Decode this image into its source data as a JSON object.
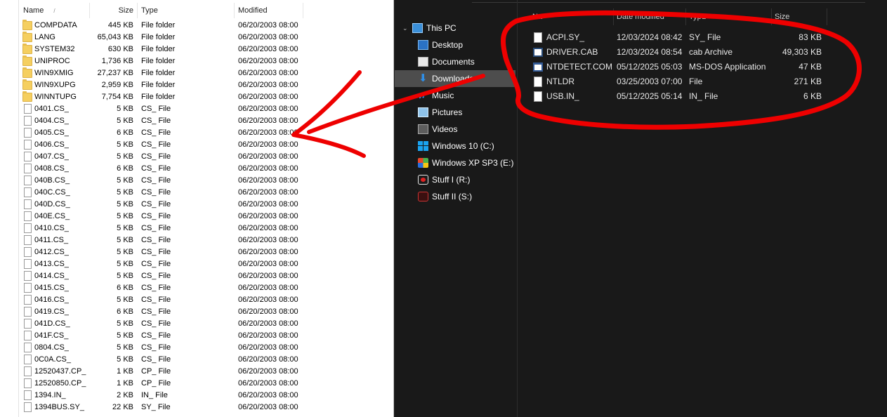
{
  "left_pane": {
    "columns": {
      "name": "Name",
      "size": "Size",
      "type": "Type",
      "modified": "Modified"
    },
    "rows": [
      {
        "name": "COMPDATA",
        "size": "445 KB",
        "type": "File folder",
        "modified": "06/20/2003 08:00",
        "icon": "folder-icon"
      },
      {
        "name": "LANG",
        "size": "65,043 KB",
        "type": "File folder",
        "modified": "06/20/2003 08:00",
        "icon": "folder-icon"
      },
      {
        "name": "SYSTEM32",
        "size": "630 KB",
        "type": "File folder",
        "modified": "06/20/2003 08:00",
        "icon": "folder-icon"
      },
      {
        "name": "UNIPROC",
        "size": "1,736 KB",
        "type": "File folder",
        "modified": "06/20/2003 08:00",
        "icon": "folder-icon"
      },
      {
        "name": "WIN9XMIG",
        "size": "27,237 KB",
        "type": "File folder",
        "modified": "06/20/2003 08:00",
        "icon": "folder-icon"
      },
      {
        "name": "WIN9XUPG",
        "size": "2,959 KB",
        "type": "File folder",
        "modified": "06/20/2003 08:00",
        "icon": "folder-icon"
      },
      {
        "name": "WINNTUPG",
        "size": "7,754 KB",
        "type": "File folder",
        "modified": "06/20/2003 08:00",
        "icon": "folder-icon"
      },
      {
        "name": "0401.CS_",
        "size": "5 KB",
        "type": "CS_ File",
        "modified": "06/20/2003 08:00",
        "icon": "file-icon"
      },
      {
        "name": "0404.CS_",
        "size": "5 KB",
        "type": "CS_ File",
        "modified": "06/20/2003 08:00",
        "icon": "file-icon"
      },
      {
        "name": "0405.CS_",
        "size": "6 KB",
        "type": "CS_ File",
        "modified": "06/20/2003 08:00",
        "icon": "file-icon"
      },
      {
        "name": "0406.CS_",
        "size": "5 KB",
        "type": "CS_ File",
        "modified": "06/20/2003 08:00",
        "icon": "file-icon"
      },
      {
        "name": "0407.CS_",
        "size": "5 KB",
        "type": "CS_ File",
        "modified": "06/20/2003 08:00",
        "icon": "file-icon"
      },
      {
        "name": "0408.CS_",
        "size": "6 KB",
        "type": "CS_ File",
        "modified": "06/20/2003 08:00",
        "icon": "file-icon"
      },
      {
        "name": "040B.CS_",
        "size": "5 KB",
        "type": "CS_ File",
        "modified": "06/20/2003 08:00",
        "icon": "file-icon"
      },
      {
        "name": "040C.CS_",
        "size": "5 KB",
        "type": "CS_ File",
        "modified": "06/20/2003 08:00",
        "icon": "file-icon"
      },
      {
        "name": "040D.CS_",
        "size": "5 KB",
        "type": "CS_ File",
        "modified": "06/20/2003 08:00",
        "icon": "file-icon"
      },
      {
        "name": "040E.CS_",
        "size": "5 KB",
        "type": "CS_ File",
        "modified": "06/20/2003 08:00",
        "icon": "file-icon"
      },
      {
        "name": "0410.CS_",
        "size": "5 KB",
        "type": "CS_ File",
        "modified": "06/20/2003 08:00",
        "icon": "file-icon"
      },
      {
        "name": "0411.CS_",
        "size": "5 KB",
        "type": "CS_ File",
        "modified": "06/20/2003 08:00",
        "icon": "file-icon"
      },
      {
        "name": "0412.CS_",
        "size": "5 KB",
        "type": "CS_ File",
        "modified": "06/20/2003 08:00",
        "icon": "file-icon"
      },
      {
        "name": "0413.CS_",
        "size": "5 KB",
        "type": "CS_ File",
        "modified": "06/20/2003 08:00",
        "icon": "file-icon"
      },
      {
        "name": "0414.CS_",
        "size": "5 KB",
        "type": "CS_ File",
        "modified": "06/20/2003 08:00",
        "icon": "file-icon"
      },
      {
        "name": "0415.CS_",
        "size": "6 KB",
        "type": "CS_ File",
        "modified": "06/20/2003 08:00",
        "icon": "file-icon"
      },
      {
        "name": "0416.CS_",
        "size": "5 KB",
        "type": "CS_ File",
        "modified": "06/20/2003 08:00",
        "icon": "file-icon"
      },
      {
        "name": "0419.CS_",
        "size": "6 KB",
        "type": "CS_ File",
        "modified": "06/20/2003 08:00",
        "icon": "file-icon"
      },
      {
        "name": "041D.CS_",
        "size": "5 KB",
        "type": "CS_ File",
        "modified": "06/20/2003 08:00",
        "icon": "file-icon"
      },
      {
        "name": "041F.CS_",
        "size": "5 KB",
        "type": "CS_ File",
        "modified": "06/20/2003 08:00",
        "icon": "file-icon"
      },
      {
        "name": "0804.CS_",
        "size": "5 KB",
        "type": "CS_ File",
        "modified": "06/20/2003 08:00",
        "icon": "file-icon"
      },
      {
        "name": "0C0A.CS_",
        "size": "5 KB",
        "type": "CS_ File",
        "modified": "06/20/2003 08:00",
        "icon": "file-icon"
      },
      {
        "name": "12520437.CP_",
        "size": "1 KB",
        "type": "CP_ File",
        "modified": "06/20/2003 08:00",
        "icon": "file-icon"
      },
      {
        "name": "12520850.CP_",
        "size": "1 KB",
        "type": "CP_ File",
        "modified": "06/20/2003 08:00",
        "icon": "file-icon"
      },
      {
        "name": "1394.IN_",
        "size": "2 KB",
        "type": "IN_ File",
        "modified": "06/20/2003 08:00",
        "icon": "file-icon"
      },
      {
        "name": "1394BUS.SY_",
        "size": "22 KB",
        "type": "SY_ File",
        "modified": "06/20/2003 08:00",
        "icon": "file-icon"
      }
    ]
  },
  "right_pane": {
    "columns": {
      "name": "Na",
      "date": "Date modified",
      "type": "Type",
      "size": "Size"
    },
    "nav": [
      {
        "label": "This PC",
        "icon": "computer-icon",
        "level": "root",
        "selected": false
      },
      {
        "label": "Desktop",
        "icon": "desktop-icon",
        "level": "child",
        "selected": false
      },
      {
        "label": "Documents",
        "icon": "documents-icon",
        "level": "child",
        "selected": false
      },
      {
        "label": "Downloads",
        "icon": "downloads-icon",
        "level": "child",
        "selected": true
      },
      {
        "label": "Music",
        "icon": "music-icon",
        "level": "child",
        "selected": false
      },
      {
        "label": "Pictures",
        "icon": "pictures-icon",
        "level": "child",
        "selected": false
      },
      {
        "label": "Videos",
        "icon": "videos-icon",
        "level": "child",
        "selected": false
      },
      {
        "label": "Windows 10 (C:)",
        "icon": "windows-drive-icon",
        "level": "child",
        "selected": false
      },
      {
        "label": "Windows XP SP3 (E:)",
        "icon": "xp-drive-icon",
        "level": "child",
        "selected": false
      },
      {
        "label": "Stuff I (R:)",
        "icon": "drive-r-icon",
        "level": "child",
        "selected": false
      },
      {
        "label": "Stuff II (S:)",
        "icon": "drive-s-icon",
        "level": "child",
        "selected": false
      }
    ],
    "files": [
      {
        "name": "ACPI.SY_",
        "date": "12/03/2024 08:42",
        "type": "SY_ File",
        "size": "83 KB",
        "icon": "file-icon"
      },
      {
        "name": "DRIVER.CAB",
        "date": "12/03/2024 08:54",
        "type": "cab Archive",
        "size": "49,303 KB",
        "icon": "cab-archive-icon"
      },
      {
        "name": "NTDETECT.COM",
        "date": "05/12/2025 05:03",
        "type": "MS-DOS Application",
        "size": "47 KB",
        "icon": "msdos-app-icon"
      },
      {
        "name": "NTLDR",
        "date": "03/25/2003 07:00",
        "type": "File",
        "size": "271 KB",
        "icon": "file-icon"
      },
      {
        "name": "USB.IN_",
        "date": "05/12/2025 05:14",
        "type": "IN_ File",
        "size": "6 KB",
        "icon": "file-icon"
      }
    ]
  },
  "colors": {
    "annotation_red": "#ee0000",
    "dark_background": "#191919",
    "selection": "#4d4d4d",
    "folder_yellow": "#f5cf60"
  }
}
